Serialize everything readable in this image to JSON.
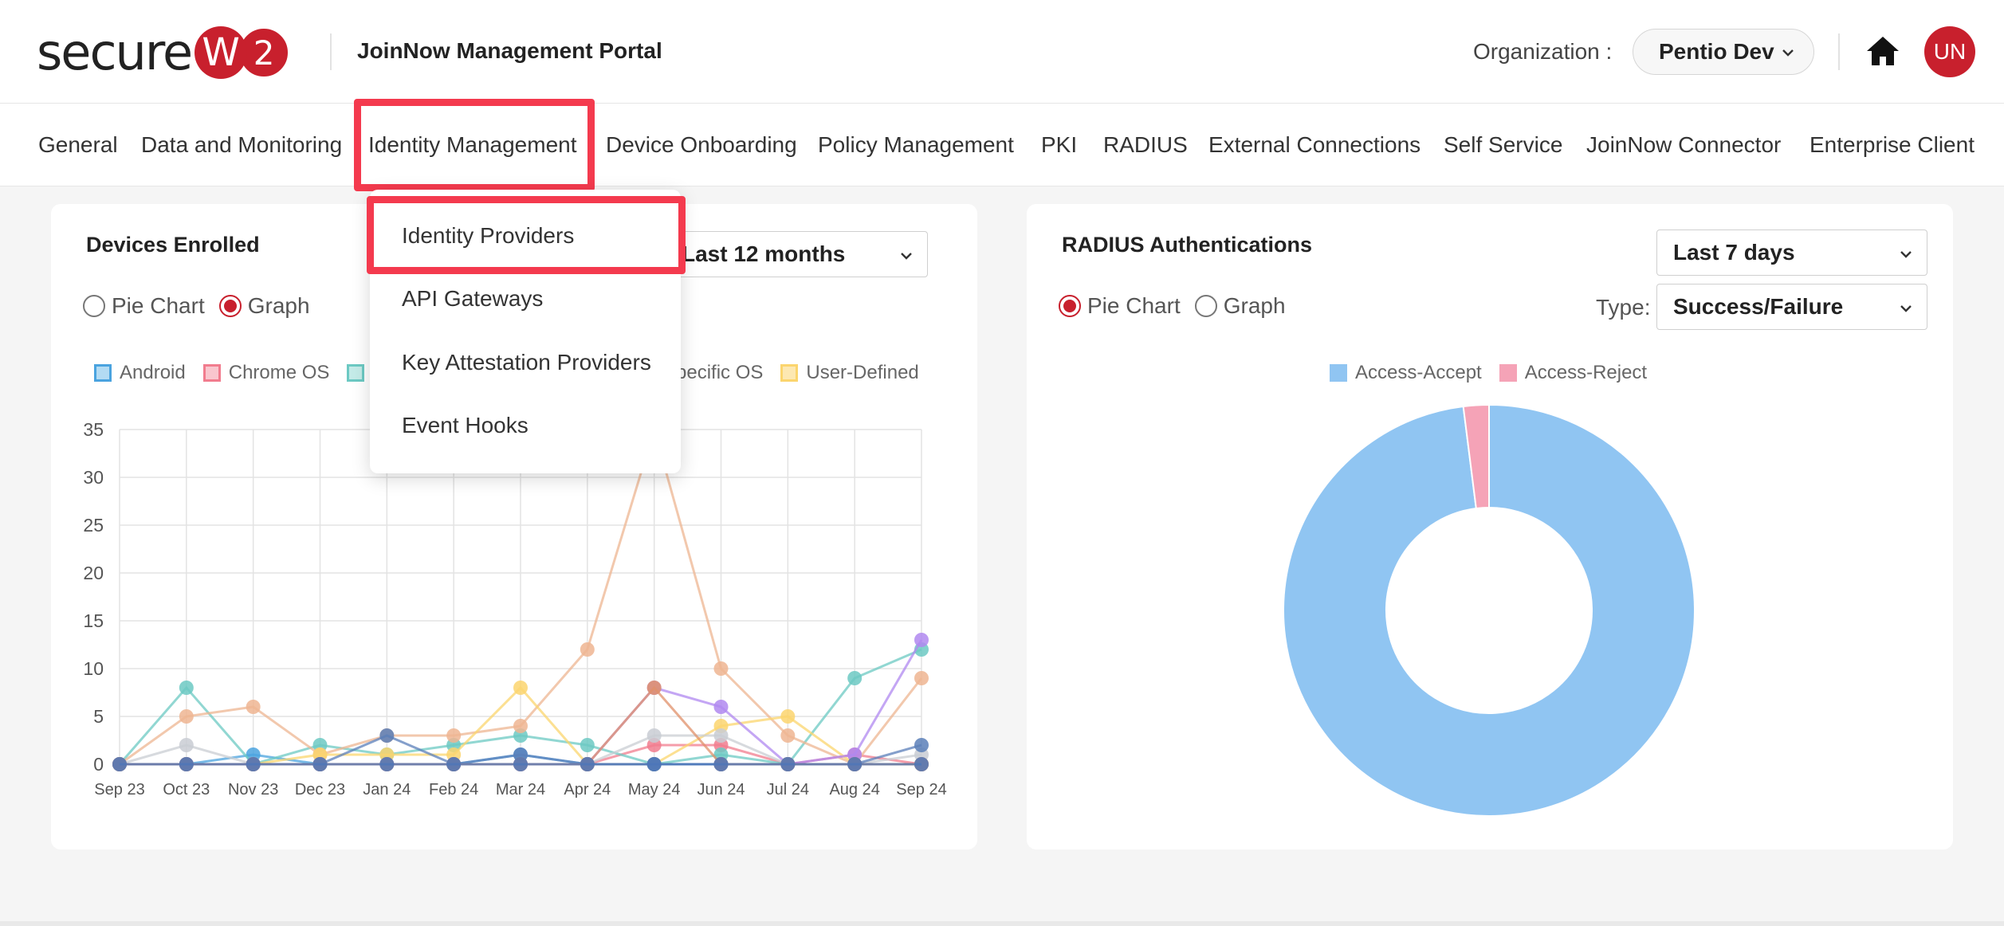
{
  "header": {
    "logo_text": "secure",
    "logo_badge_w": "W",
    "logo_badge_2": "2",
    "portal_title": "JoinNow Management Portal",
    "org_label": "Organization :",
    "org_value": "Pentio Dev",
    "avatar_initials": "UN"
  },
  "nav": {
    "items": [
      "General",
      "Data and Monitoring",
      "Identity Management",
      "Device Onboarding",
      "Policy Management",
      "PKI",
      "RADIUS",
      "External Connections",
      "Self Service",
      "JoinNow Connector",
      "Enterprise Client"
    ]
  },
  "dropdown": {
    "items": [
      "Identity Providers",
      "API Gateways",
      "Key Attestation Providers",
      "Event Hooks"
    ]
  },
  "devices_card": {
    "title": "Devices Enrolled",
    "period": "Last 12 months",
    "radio_pie": "Pie Chart",
    "radio_graph": "Graph",
    "legend_android": "Android",
    "legend_chromeos": "Chrome OS",
    "legend_specific": "specific OS",
    "legend_userdefined": "User-Defined"
  },
  "radius_card": {
    "title": "RADIUS Authentications",
    "period": "Last 7 days",
    "radio_pie": "Pie Chart",
    "radio_graph": "Graph",
    "type_label": "Type:",
    "type_value": "Success/Failure"
  },
  "colors": {
    "brand": "#c8202d",
    "highlight": "#f43a4e",
    "android": "#4aa3df",
    "chromeos": "#f17c8e",
    "teal": "#6cc9c3",
    "peach": "#eeb592",
    "yellow": "#fbd56e",
    "purple": "#b088f0",
    "grey": "#c9cdd3",
    "navy": "#5b7fb9",
    "accept": "#90c5f2",
    "reject": "#f5a3b7"
  },
  "chart_data": [
    {
      "type": "line",
      "title": "Devices Enrolled",
      "categories": [
        "Sep 23",
        "Oct 23",
        "Nov 23",
        "Dec 23",
        "Jan 24",
        "Feb 24",
        "Mar 24",
        "Apr 24",
        "May 24",
        "Jun 24",
        "Jul 24",
        "Aug 24",
        "Sep 24"
      ],
      "ylim": [
        0,
        35
      ],
      "yticks": [
        0,
        5,
        10,
        15,
        20,
        25,
        30,
        35
      ],
      "grid": true,
      "legend_position": "top",
      "series": [
        {
          "name": "Android",
          "color": "#4aa3df",
          "values": [
            0,
            0,
            1,
            0,
            0,
            0,
            1,
            0,
            0,
            0,
            0,
            0,
            0
          ]
        },
        {
          "name": "Chrome OS",
          "color": "#f17c8e",
          "values": [
            0,
            0,
            0,
            0,
            0,
            0,
            0,
            0,
            2,
            2,
            0,
            1,
            0
          ]
        },
        {
          "color": "#6cc9c3",
          "values": [
            0,
            8,
            0,
            2,
            1,
            2,
            3,
            2,
            0,
            1,
            0,
            9,
            12
          ]
        },
        {
          "color": "#eeb592",
          "values": [
            0,
            5,
            6,
            1,
            3,
            3,
            4,
            12,
            35,
            10,
            3,
            0,
            9
          ]
        },
        {
          "name": "User-Defined",
          "color": "#fbd56e",
          "values": [
            0,
            0,
            0,
            1,
            1,
            1,
            8,
            0,
            0,
            4,
            5,
            0,
            0
          ]
        },
        {
          "color": "#b088f0",
          "values": [
            0,
            0,
            0,
            0,
            0,
            0,
            0,
            0,
            8,
            6,
            0,
            1,
            13
          ]
        },
        {
          "color": "#c9cdd3",
          "values": [
            0,
            2,
            0,
            0,
            0,
            0,
            0,
            0,
            3,
            3,
            0,
            0,
            1
          ]
        },
        {
          "color": "#5b7fb9",
          "values": [
            0,
            0,
            0,
            0,
            3,
            0,
            1,
            0,
            0,
            0,
            0,
            0,
            2
          ]
        },
        {
          "color": "#e0906a",
          "values": [
            0,
            0,
            0,
            0,
            0,
            0,
            0,
            0,
            8,
            0,
            0,
            0,
            0
          ]
        },
        {
          "color": "#4c76b8",
          "values": [
            0,
            0,
            0,
            0,
            0,
            0,
            0,
            0,
            0,
            0,
            0,
            0,
            0
          ]
        }
      ]
    },
    {
      "type": "pie",
      "title": "RADIUS Authentications",
      "donut": true,
      "legend_position": "top",
      "categories": [
        "Access-Accept",
        "Access-Reject"
      ],
      "values": [
        98,
        2
      ],
      "colors": [
        "#90c5f2",
        "#f5a3b7"
      ]
    }
  ]
}
